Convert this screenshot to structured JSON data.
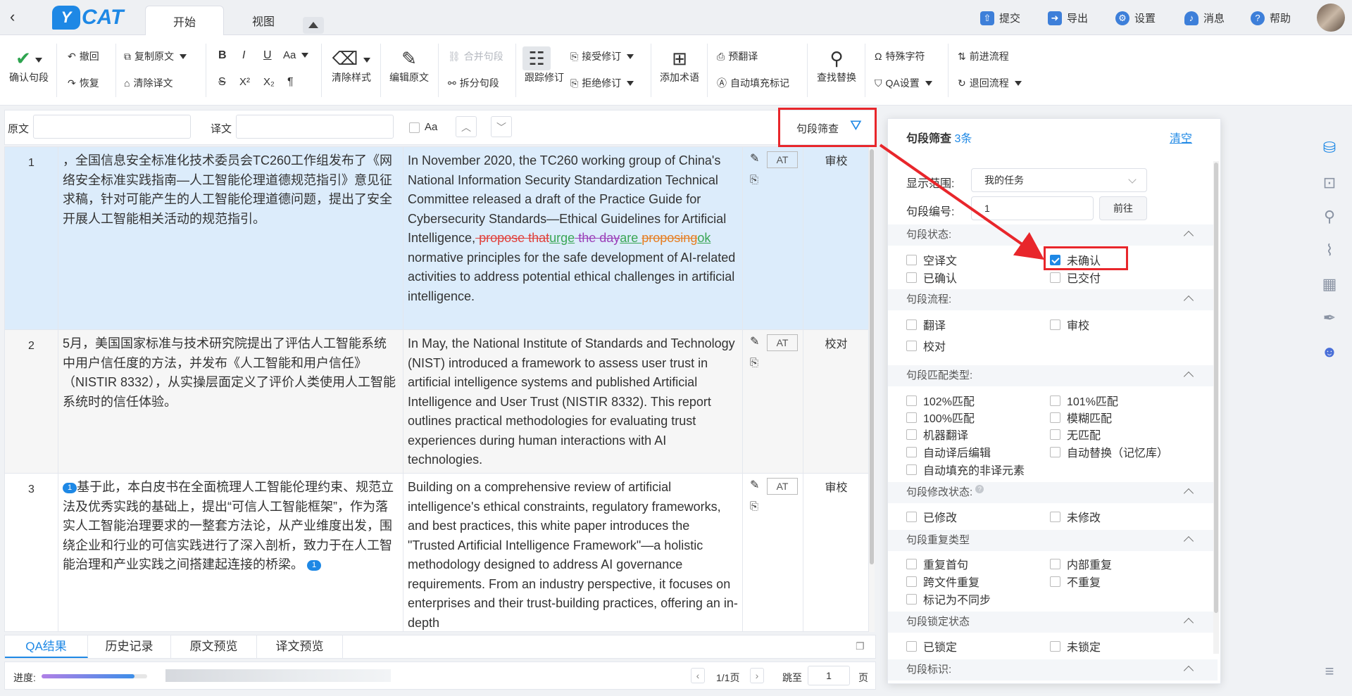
{
  "app": {
    "logo_mark": "Y",
    "logo_text": "CAT"
  },
  "tabs": [
    "开始",
    "视图"
  ],
  "top_actions": [
    {
      "label": "提交",
      "icon": "submit-icon"
    },
    {
      "label": "导出",
      "icon": "export-icon"
    },
    {
      "label": "设置",
      "icon": "gear-icon"
    },
    {
      "label": "消息",
      "icon": "bell-icon"
    },
    {
      "label": "帮助",
      "icon": "help-icon"
    }
  ],
  "toolbar": {
    "confirm": "确认句段",
    "undo": "撤回",
    "redo": "恢复",
    "copy_source": "复制原文",
    "clear_target": "清除译文",
    "bold": "B",
    "italic": "I",
    "underline": "U",
    "case": "Aa",
    "strike": "S",
    "sup": "X²",
    "sub": "X₂",
    "pilcrow": "¶",
    "clear_style": "清除样式",
    "edit_source": "编辑原文",
    "merge": "合并句段",
    "split": "拆分句段",
    "track": "跟踪修订",
    "accept": "接受修订",
    "reject": "拒绝修订",
    "add_term": "添加术语",
    "pretranslate": "预翻译",
    "autofill": "自动填充标记",
    "find_replace": "查找替换",
    "special_chars": "特殊字符",
    "qa_settings": "QA设置",
    "forward_flow": "前进流程",
    "back_flow": "退回流程"
  },
  "search": {
    "source_label": "原文",
    "target_label": "译文",
    "case_label": "Aa",
    "filter_label": "句段筛查"
  },
  "segments": [
    {
      "num": "1",
      "status": "审校",
      "source": "，全国信息安全标准化技术委员会TC260工作组发布了《网络安全标准实践指南—人工智能伦理道德规范指引》意见征求稿，针对可能产生的人工智能伦理道德问题，提出了安全开展人工智能相关活动的规范指引。",
      "target_a": "In November 2020, the TC260 working group of China's National Information Security Standardization Technical Committee released a draft of the Practice Guide for Cybersecurity Standards—Ethical Guidelines for Artificial Intelligence,",
      "del1": " propose that",
      "ins1": "urge",
      "del2": " the day",
      "ins2": "are ",
      "del3": "proposing",
      "ins3": "ok",
      "target_b": " normative principles for the safe development of AI-related activities to address potential ethical challenges in artificial intelligence."
    },
    {
      "num": "2",
      "status": "校对",
      "source": "5月，美国国家标准与技术研究院提出了评估人工智能系统中用户信任度的方法，并发布《人工智能和用户信任》（NISTIR 8332），从实操层面定义了评价人类使用人工智能系统时的信任体验。",
      "target": "In May, the National Institute of Standards and Technology (NIST) introduced a framework to assess user trust in artificial intelligence systems and published Artificial Intelligence and User Trust (NISTIR 8332). This report outlines practical methodologies for evaluating trust experiences during human interactions with AI technologies."
    },
    {
      "num": "3",
      "status": "审校",
      "tag": "1",
      "source": "基于此，本白皮书在全面梳理人工智能伦理约束、规范立法及优秀实践的基础上，提出“可信人工智能框架”，作为落实人工智能治理要求的一整套方法论，从产业维度出发，围绕企业和行业的可信实践进行了深入剖析，致力于在人工智能治理和产业实践之间搭建起连接的桥梁。",
      "target": "Building on a comprehensive review of artificial intelligence's ethical constraints, regulatory frameworks, and best practices, this white paper introduces the \"Trusted Artificial Intelligence Framework\"—a holistic methodology designed to address AI governance requirements. From an industry perspective, it focuses on enterprises and their trust-building practices, offering an in-depth"
    }
  ],
  "at_label": "AT",
  "bottom_tabs": [
    "QA结果",
    "历史记录",
    "原文预览",
    "译文预览"
  ],
  "status_bar": {
    "progress_label": "进度:",
    "progress": 0.88,
    "page_info": "1/1页",
    "jump_label": "跳至",
    "page_value": "1",
    "page_unit": "页"
  },
  "filter_panel": {
    "title": "句段筛查",
    "count": "3条",
    "clear": "清空",
    "scope_label": "显示范围:",
    "scope_value": "我的任务",
    "segnum_label": "句段编号:",
    "segnum_value": "1",
    "go": "前往",
    "sections": {
      "status": "句段状态:",
      "flow": "句段流程:",
      "match": "句段匹配类型:",
      "modify": "句段修改状态:",
      "repeat": "句段重复类型",
      "lock": "句段锁定状态",
      "mark": "句段标识:"
    },
    "status_opts": [
      "空译文",
      "未确认",
      "已确认",
      "已交付"
    ],
    "flow_opts": [
      "翻译",
      "审校",
      "校对"
    ],
    "match_opts": [
      "102%匹配",
      "101%匹配",
      "100%匹配",
      "模糊匹配",
      "机器翻译",
      "无匹配",
      "自动译后编辑",
      "自动替换（记忆库）",
      "自动填充的非译元素"
    ],
    "modify_opts": [
      "已修改",
      "未修改"
    ],
    "repeat_opts": [
      "重复首句",
      "内部重复",
      "跨文件重复",
      "不重复",
      "标记为不同步"
    ],
    "lock_opts": [
      "已锁定",
      "未锁定"
    ],
    "checked": "未确认"
  },
  "colors": {
    "accent": "#1e88e5",
    "highlight_row": "#dcecfb",
    "annotation": "#e8262b"
  }
}
